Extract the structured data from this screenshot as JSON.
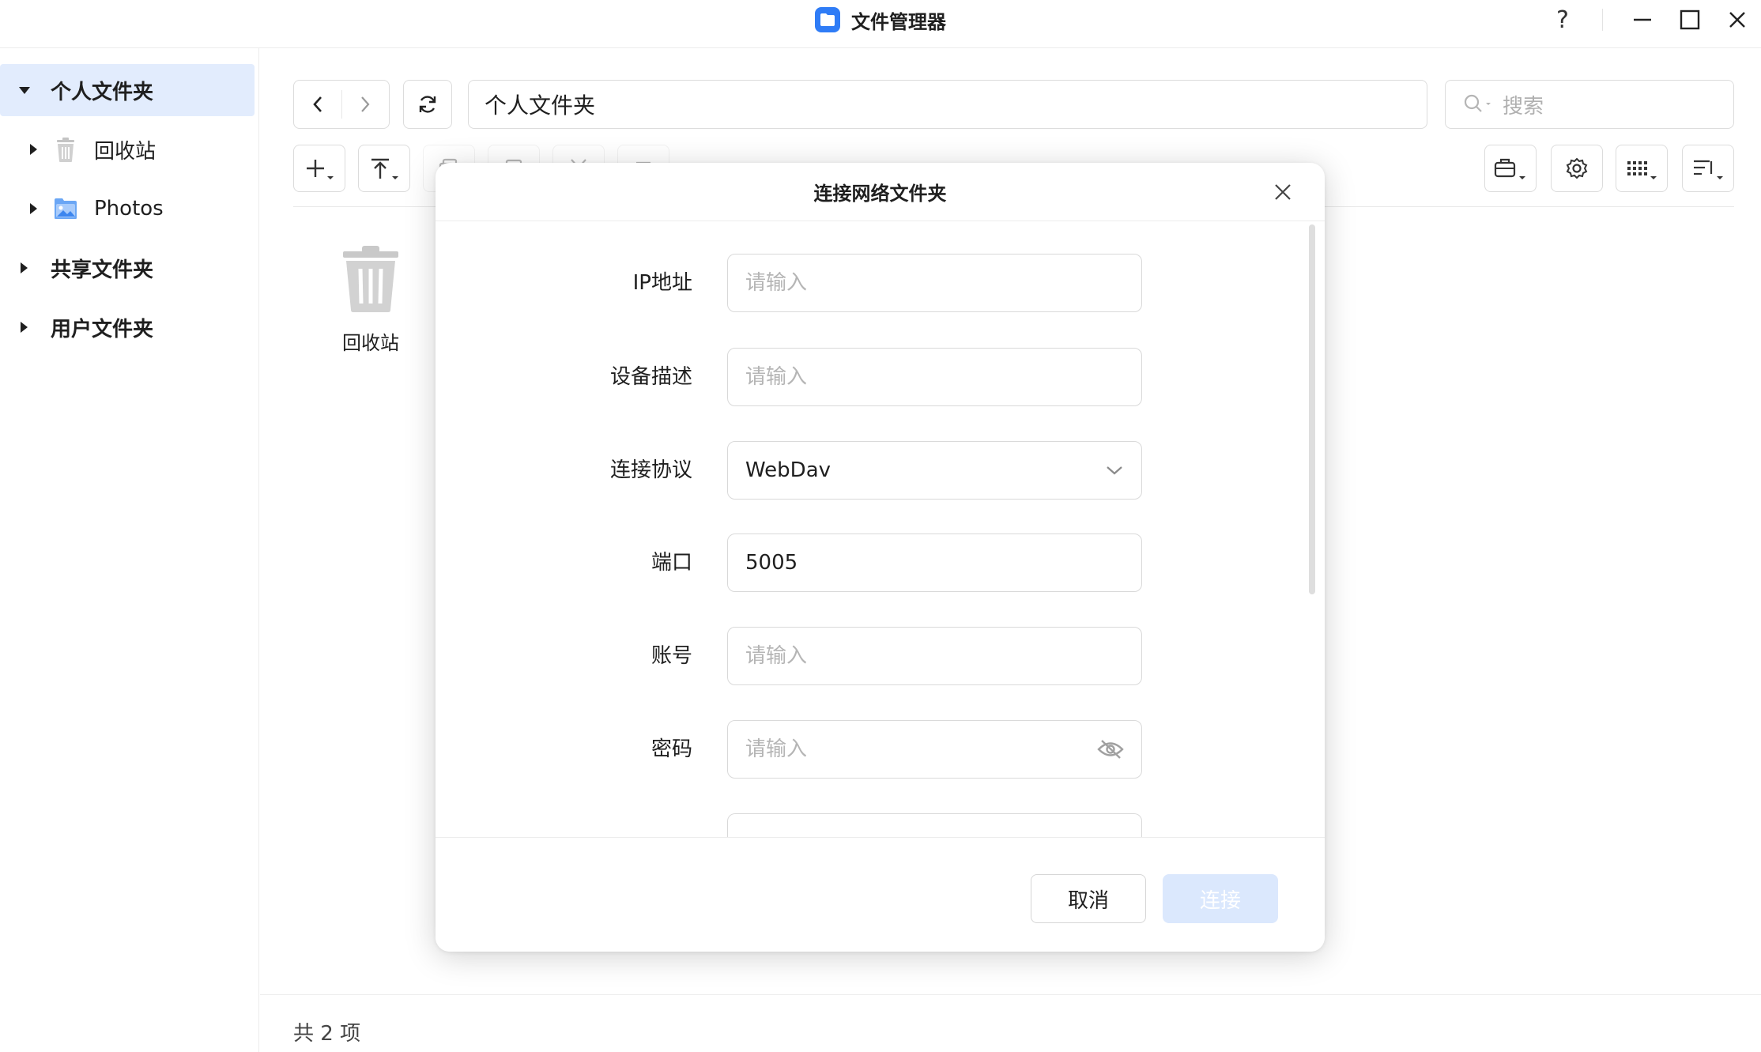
{
  "window": {
    "title": "文件管理器",
    "help_label": "?"
  },
  "sidebar": {
    "items": [
      {
        "label": "个人文件夹",
        "level": 0,
        "expanded": true,
        "selected": true,
        "icon": "none"
      },
      {
        "label": "回收站",
        "level": 1,
        "expanded": false,
        "selected": false,
        "icon": "trash-icon"
      },
      {
        "label": "Photos",
        "level": 1,
        "expanded": false,
        "selected": false,
        "icon": "photo-folder-icon"
      },
      {
        "label": "共享文件夹",
        "level": 0,
        "expanded": false,
        "selected": false,
        "icon": "none"
      },
      {
        "label": "用户文件夹",
        "level": 0,
        "expanded": false,
        "selected": false,
        "icon": "none"
      }
    ]
  },
  "toolbar": {
    "path": "个人文件夹",
    "search_placeholder": "搜索"
  },
  "content": {
    "files": [
      {
        "name": "回收站",
        "icon": "trash-icon"
      }
    ]
  },
  "status": {
    "count_text": "共 2 项"
  },
  "dialog": {
    "title": "连接网络文件夹",
    "fields": {
      "ip": {
        "label": "IP地址",
        "placeholder": "请输入",
        "value": ""
      },
      "description": {
        "label": "设备描述",
        "placeholder": "请输入",
        "value": ""
      },
      "protocol": {
        "label": "连接协议",
        "value": "WebDav"
      },
      "port": {
        "label": "端口",
        "placeholder": "请输入",
        "value": "5005"
      },
      "account": {
        "label": "账号",
        "placeholder": "请输入",
        "value": ""
      },
      "password": {
        "label": "密码",
        "placeholder": "请输入",
        "value": ""
      }
    },
    "cancel_label": "取消",
    "connect_label": "连接"
  },
  "colors": {
    "accent": "#2f7cf6",
    "selected_bg": "#e2ecfd",
    "primary_disabled": "#dbe8fd"
  }
}
